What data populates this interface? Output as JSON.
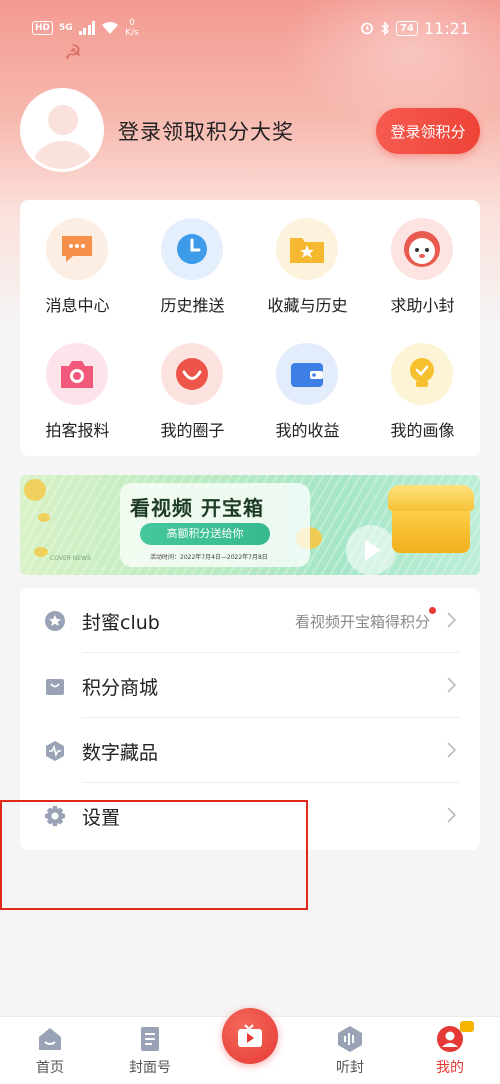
{
  "status_bar": {
    "hd": "HD",
    "net": "5G",
    "speed_value": "0",
    "speed_unit": "K/s",
    "battery": "74",
    "time": "11:21"
  },
  "profile": {
    "title": "登录领取积分大奖",
    "login_button": "登录领积分"
  },
  "grid": [
    {
      "label": "消息中心",
      "icon": "message-icon",
      "color": "#f4904a"
    },
    {
      "label": "历史推送",
      "icon": "clock-icon",
      "color": "#3d9be9"
    },
    {
      "label": "收藏与历史",
      "icon": "folder-star-icon",
      "color": "#f5b82e"
    },
    {
      "label": "求助小封",
      "icon": "mascot-icon",
      "color": "#e95b4f"
    },
    {
      "label": "拍客报料",
      "icon": "camera-icon",
      "color": "#f2587a"
    },
    {
      "label": "我的圈子",
      "icon": "smile-bubble-icon",
      "color": "#ee5548"
    },
    {
      "label": "我的收益",
      "icon": "wallet-icon",
      "color": "#3e7fe6"
    },
    {
      "label": "我的画像",
      "icon": "bulb-icon",
      "color": "#f6c02e"
    }
  ],
  "banner": {
    "title": "看视频 开宝箱",
    "subtitle": "高额积分送给你",
    "date": "活动时间：2022年7月4日—2022年7月8日",
    "brand": "COVER NEWS"
  },
  "menu": [
    {
      "label": "封蜜club",
      "hint": "看视频开宝箱得积分",
      "icon": "star-circle-icon"
    },
    {
      "label": "积分商城",
      "hint": "",
      "icon": "shopping-bag-icon"
    },
    {
      "label": "数字藏品",
      "hint": "",
      "icon": "hexagon-pulse-icon"
    },
    {
      "label": "设置",
      "hint": "",
      "icon": "gear-icon"
    }
  ],
  "nav": [
    {
      "label": "首页",
      "icon": "home-icon"
    },
    {
      "label": "封面号",
      "icon": "document-icon"
    },
    {
      "label": "",
      "icon": "tv-play-icon"
    },
    {
      "label": "听封",
      "icon": "audio-icon"
    },
    {
      "label": "我的",
      "icon": "user-icon"
    }
  ],
  "colors": {
    "accent": "#e53935",
    "header_top": "#f39a92",
    "highlight_box": "#e0291b"
  }
}
